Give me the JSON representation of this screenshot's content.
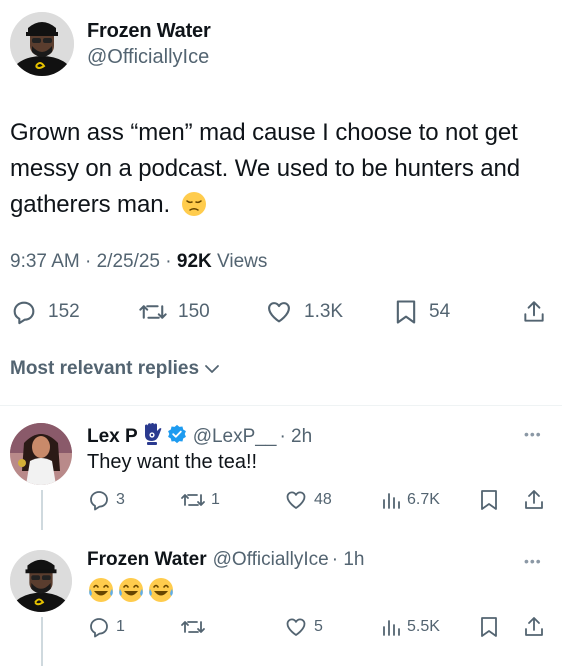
{
  "tweet": {
    "author_name": "Frozen Water",
    "author_handle": "@OfficiallyIce",
    "text": "Grown ass “men” mad cause I choose to not get messy on a podcast. We used to be hunters and gatherers man.",
    "emoji": "pensive-face-emoji",
    "time": "9:37 AM",
    "date": "2/25/25",
    "views_count": "92K",
    "views_label": "Views",
    "meta_sep": "·"
  },
  "actions": {
    "replies": "152",
    "reposts": "150",
    "likes": "1.3K",
    "bookmarks": "54"
  },
  "replies_header": "Most relevant replies",
  "replies": [
    {
      "name": "Lex P",
      "handle": "@LexP__",
      "time": "· 2h",
      "text": "They want the tea!!",
      "replies": "3",
      "reposts": "1",
      "likes": "48",
      "views": "6.7K"
    },
    {
      "name": "Frozen Water",
      "handle": "@OfficiallyIce",
      "time": "· 1h",
      "text": "",
      "emojis": [
        "joy-emoji",
        "joy-emoji",
        "joy-emoji"
      ],
      "replies": "1",
      "reposts": "",
      "likes": "5",
      "views": "5.5K"
    }
  ],
  "colors": {
    "text": "#0f1419",
    "secondary": "#536471",
    "verified": "#1d9bf0",
    "divider": "#eff3f4"
  }
}
